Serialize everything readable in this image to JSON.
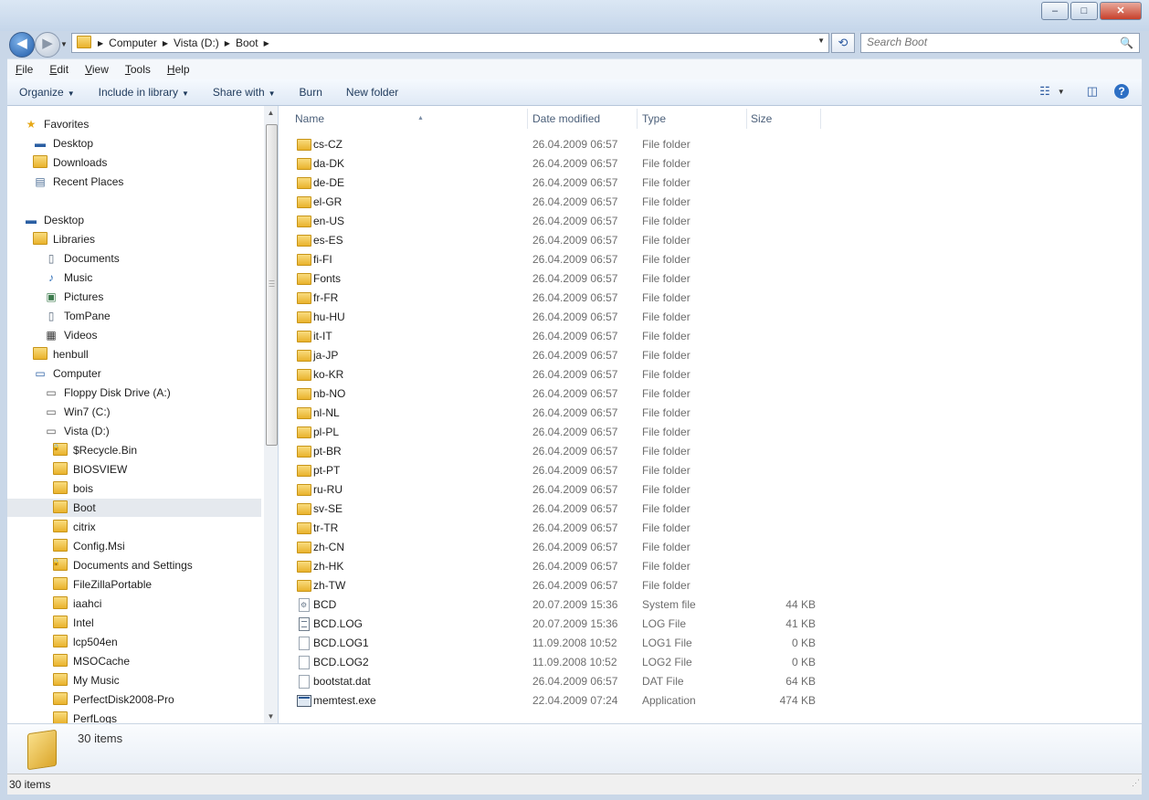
{
  "window": {
    "minimize": "–",
    "maximize": "□",
    "close": "✕"
  },
  "nav": {
    "back_icon": "back-arrow-icon",
    "forward_icon": "forward-arrow-icon"
  },
  "address": {
    "crumbs": [
      "Computer",
      "Vista (D:)",
      "Boot"
    ]
  },
  "search": {
    "placeholder": "Search Boot"
  },
  "menu": [
    {
      "u": "F",
      "rest": "ile"
    },
    {
      "u": "E",
      "rest": "dit"
    },
    {
      "u": "V",
      "rest": "iew"
    },
    {
      "u": "T",
      "rest": "ools"
    },
    {
      "u": "H",
      "rest": "elp"
    }
  ],
  "toolbar": {
    "organize": "Organize",
    "include": "Include in library",
    "share": "Share with",
    "burn": "Burn",
    "new_folder": "New folder"
  },
  "navpane": {
    "favorites": "Favorites",
    "desktop_fav": "Desktop",
    "downloads": "Downloads",
    "recent": "Recent Places",
    "desktop": "Desktop",
    "libraries": "Libraries",
    "documents": "Documents",
    "music": "Music",
    "pictures": "Pictures",
    "tompane": "TomPane",
    "videos": "Videos",
    "henbull": "henbull",
    "computer": "Computer",
    "floppy": "Floppy Disk Drive (A:)",
    "win7": "Win7 (C:)",
    "vista": "Vista (D:)",
    "folders": [
      "$Recycle.Bin",
      "BIOSVIEW",
      "bois",
      "Boot",
      "citrix",
      "Config.Msi",
      "Documents and Settings",
      "FileZillaPortable",
      "iaahci",
      "Intel",
      "lcp504en",
      "MSOCache",
      "My Music",
      "PerfectDisk2008-Pro",
      "PerfLogs"
    ]
  },
  "columns": {
    "name": "Name",
    "date": "Date modified",
    "type": "Type",
    "size": "Size"
  },
  "files": [
    {
      "name": "cs-CZ",
      "date": "26.04.2009 06:57",
      "type": "File folder",
      "size": ""
    },
    {
      "name": "da-DK",
      "date": "26.04.2009 06:57",
      "type": "File folder",
      "size": ""
    },
    {
      "name": "de-DE",
      "date": "26.04.2009 06:57",
      "type": "File folder",
      "size": ""
    },
    {
      "name": "el-GR",
      "date": "26.04.2009 06:57",
      "type": "File folder",
      "size": ""
    },
    {
      "name": "en-US",
      "date": "26.04.2009 06:57",
      "type": "File folder",
      "size": ""
    },
    {
      "name": "es-ES",
      "date": "26.04.2009 06:57",
      "type": "File folder",
      "size": ""
    },
    {
      "name": "fi-FI",
      "date": "26.04.2009 06:57",
      "type": "File folder",
      "size": ""
    },
    {
      "name": "Fonts",
      "date": "26.04.2009 06:57",
      "type": "File folder",
      "size": ""
    },
    {
      "name": "fr-FR",
      "date": "26.04.2009 06:57",
      "type": "File folder",
      "size": ""
    },
    {
      "name": "hu-HU",
      "date": "26.04.2009 06:57",
      "type": "File folder",
      "size": ""
    },
    {
      "name": "it-IT",
      "date": "26.04.2009 06:57",
      "type": "File folder",
      "size": ""
    },
    {
      "name": "ja-JP",
      "date": "26.04.2009 06:57",
      "type": "File folder",
      "size": ""
    },
    {
      "name": "ko-KR",
      "date": "26.04.2009 06:57",
      "type": "File folder",
      "size": ""
    },
    {
      "name": "nb-NO",
      "date": "26.04.2009 06:57",
      "type": "File folder",
      "size": ""
    },
    {
      "name": "nl-NL",
      "date": "26.04.2009 06:57",
      "type": "File folder",
      "size": ""
    },
    {
      "name": "pl-PL",
      "date": "26.04.2009 06:57",
      "type": "File folder",
      "size": ""
    },
    {
      "name": "pt-BR",
      "date": "26.04.2009 06:57",
      "type": "File folder",
      "size": ""
    },
    {
      "name": "pt-PT",
      "date": "26.04.2009 06:57",
      "type": "File folder",
      "size": ""
    },
    {
      "name": "ru-RU",
      "date": "26.04.2009 06:57",
      "type": "File folder",
      "size": ""
    },
    {
      "name": "sv-SE",
      "date": "26.04.2009 06:57",
      "type": "File folder",
      "size": ""
    },
    {
      "name": "tr-TR",
      "date": "26.04.2009 06:57",
      "type": "File folder",
      "size": ""
    },
    {
      "name": "zh-CN",
      "date": "26.04.2009 06:57",
      "type": "File folder",
      "size": ""
    },
    {
      "name": "zh-HK",
      "date": "26.04.2009 06:57",
      "type": "File folder",
      "size": ""
    },
    {
      "name": "zh-TW",
      "date": "26.04.2009 06:57",
      "type": "File folder",
      "size": ""
    },
    {
      "name": "BCD",
      "date": "20.07.2009 15:36",
      "type": "System file",
      "size": "44 KB"
    },
    {
      "name": "BCD.LOG",
      "date": "20.07.2009 15:36",
      "type": "LOG File",
      "size": "41 KB"
    },
    {
      "name": "BCD.LOG1",
      "date": "11.09.2008 10:52",
      "type": "LOG1 File",
      "size": "0 KB"
    },
    {
      "name": "BCD.LOG2",
      "date": "11.09.2008 10:52",
      "type": "LOG2 File",
      "size": "0 KB"
    },
    {
      "name": "bootstat.dat",
      "date": "26.04.2009 06:57",
      "type": "DAT File",
      "size": "64 KB"
    },
    {
      "name": "memtest.exe",
      "date": "22.04.2009 07:24",
      "type": "Application",
      "size": "474 KB"
    }
  ],
  "details": {
    "count": "30 items"
  },
  "status": {
    "text": "30 items"
  }
}
